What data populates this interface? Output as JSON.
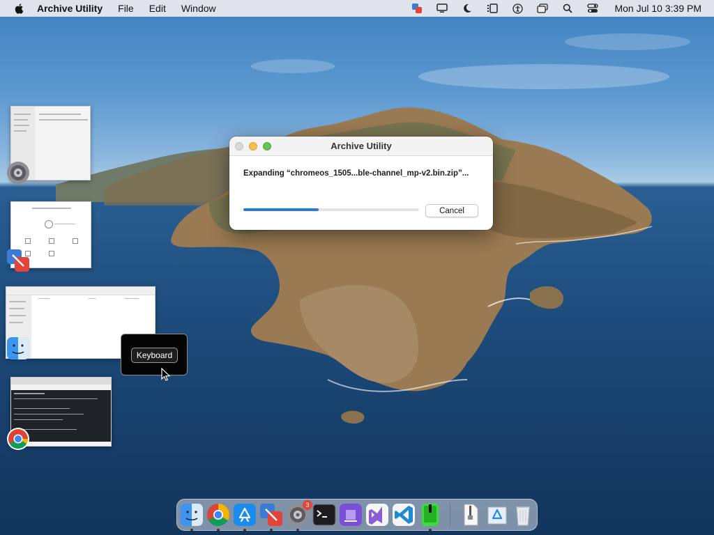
{
  "menubar": {
    "app_name": "Archive Utility",
    "menus": [
      "File",
      "Edit",
      "Window"
    ],
    "clock": "Mon Jul 10  3:39 PM"
  },
  "archive_window": {
    "title": "Archive Utility",
    "status_text": "Expanding “chromeos_1505...ble-channel_mp-v2.bin.zip”...",
    "progress_fraction": 0.43,
    "cancel_label": "Cancel"
  },
  "switcher": {
    "tooltip_label": "Keyboard"
  },
  "dock": {
    "items": [
      {
        "name": "finder-icon",
        "running": true
      },
      {
        "name": "chrome-icon",
        "running": true
      },
      {
        "name": "app-store-icon",
        "running": true
      },
      {
        "name": "migration-assistant-icon",
        "running": true
      },
      {
        "name": "system-preferences-icon",
        "running": true,
        "badge": "3"
      },
      {
        "name": "terminal-icon",
        "running": false
      },
      {
        "name": "notes-purple-icon",
        "running": false
      },
      {
        "name": "visual-studio-icon",
        "running": false
      },
      {
        "name": "vscode-icon",
        "running": false
      },
      {
        "name": "green-phone-icon",
        "running": true
      },
      {
        "name": "archive-file-icon",
        "running": false
      },
      {
        "name": "app-store-downloads-icon",
        "running": false
      },
      {
        "name": "trash-icon",
        "running": false
      }
    ]
  },
  "colors": {
    "accent": "#2a7ae2",
    "close": "#d8d8d8",
    "minimize": "#f5bf4f",
    "zoom": "#61c554"
  }
}
